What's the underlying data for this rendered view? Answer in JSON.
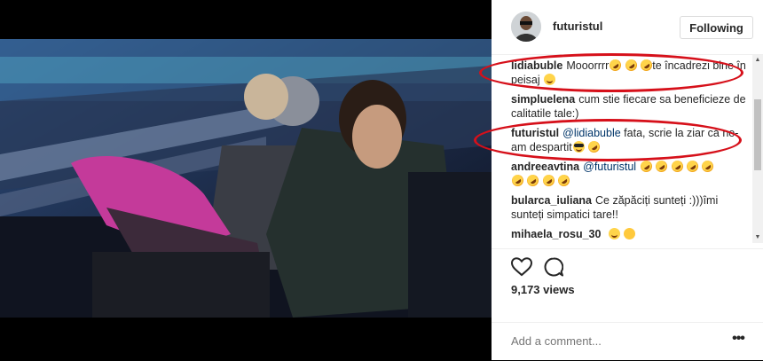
{
  "post": {
    "username": "futuristul",
    "follow_label": "Following",
    "views": "9,173 views",
    "add_comment_placeholder": "Add a comment...",
    "more_options": "•••"
  },
  "icons": {
    "avatar": "profile-avatar",
    "like": "heart-icon",
    "comment": "comment-bubble-icon",
    "more": "more-options-icon",
    "scroll_up": "chevron-up-icon",
    "scroll_down": "chevron-down-icon"
  },
  "colors": {
    "highlight_ellipse": "#d6101a",
    "mention": "#003569",
    "text": "#262626"
  },
  "comments": [
    {
      "user": "lidiabuble",
      "text_a": "Mooorrrr",
      "text_b": "te încadrezi bine în peisaj"
    },
    {
      "user": "simpluelena",
      "text": "cum stie fiecare sa beneficieze de calitatile tale:)"
    },
    {
      "user": "futuristul",
      "mention": "@lidiabuble",
      "text": "fata, scrie la ziar că ne-am despartit"
    },
    {
      "user": "andreeavtina",
      "mention": "@futuristul"
    },
    {
      "user": "bularca_iuliana",
      "text": "Ce zăpăciți sunteți :)))îmi sunteți simpatici tare!!"
    },
    {
      "user": "mihaela_rosu_30"
    }
  ]
}
